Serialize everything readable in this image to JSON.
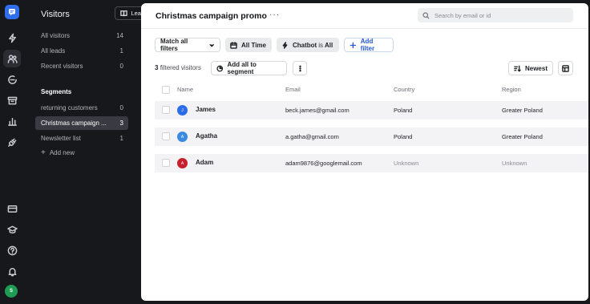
{
  "rail": {
    "items": [
      "bolt-icon",
      "users-icon",
      "chat-icon",
      "archive-icon",
      "chart-icon",
      "plug-icon"
    ],
    "bottom": [
      "card-icon",
      "graduation-icon",
      "help-icon",
      "bell-icon"
    ],
    "user_initial": "S"
  },
  "nav": {
    "title": "Visitors",
    "learn_label": "Learn",
    "items": [
      {
        "label": "All visitors",
        "count": "14"
      },
      {
        "label": "All leads",
        "count": "1"
      },
      {
        "label": "Recent visitors",
        "count": "0"
      }
    ],
    "segments_heading": "Segments",
    "segments": [
      {
        "label": "returning customers",
        "count": "0"
      },
      {
        "label": "Christmas campaign ...",
        "count": "3"
      },
      {
        "label": "Newsletter list",
        "count": "1"
      }
    ],
    "add_new_label": "Add new"
  },
  "main": {
    "title": "Christmas campaign promo",
    "more_label": "···",
    "search_placeholder": "Search by email or id",
    "filters": {
      "match_label": "Match all filters",
      "time_label": "All Time",
      "chatbot_field": "Chatbot",
      "chatbot_op": "is",
      "chatbot_value": "All",
      "add_filter_label": "Add filter"
    },
    "summary": {
      "count": "3",
      "suffix": "filtered visitors"
    },
    "add_segment_label": "Add all to segment",
    "sort_label": "Newest",
    "columns": [
      "Name",
      "Email",
      "Country",
      "Region"
    ],
    "rows": [
      {
        "initial": "J",
        "name": "James",
        "email": "beck.james@gmail.com",
        "country": "Poland",
        "region": "Greater Poland",
        "color": "#2b6de8"
      },
      {
        "initial": "A",
        "name": "Agatha",
        "email": "a.gatha@gmail.com",
        "country": "Poland",
        "region": "Greater Poland",
        "color": "#3b8ae0"
      },
      {
        "initial": "A",
        "name": "Adam",
        "email": "adam9876@googlemail.com",
        "country": "Unknown",
        "region": "Unknown",
        "color": "#c8202a"
      }
    ]
  },
  "colors": {
    "accent": "#2f6fed",
    "user_avatar": "#1f9d55"
  }
}
